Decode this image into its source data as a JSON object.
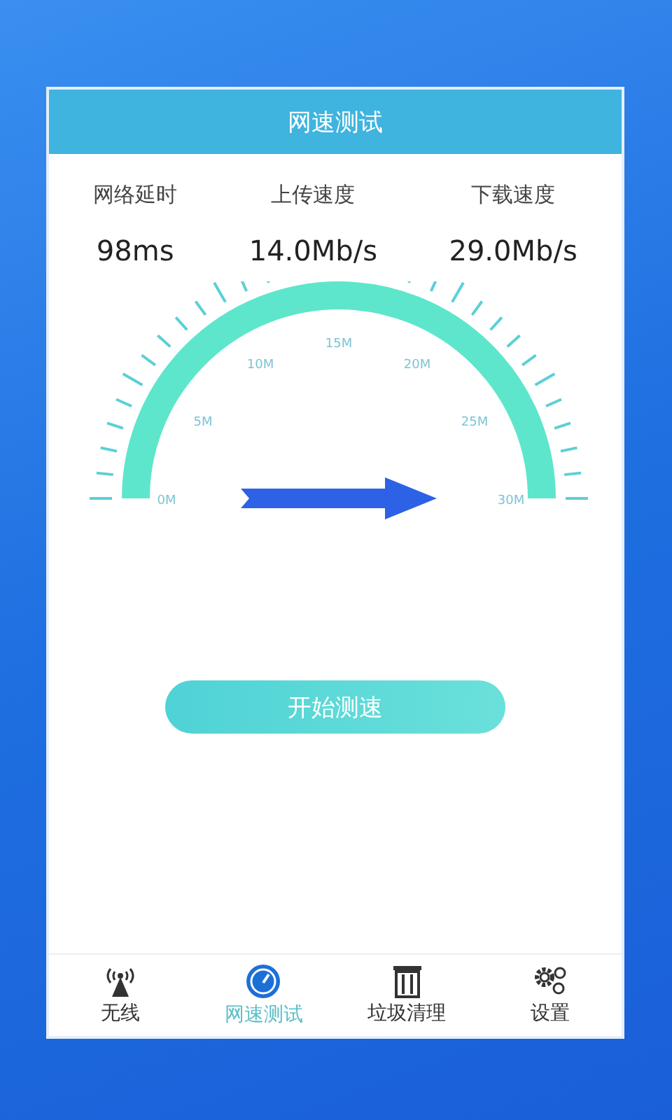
{
  "header": {
    "title": "网速测试"
  },
  "stats": [
    {
      "label": "网络延时",
      "value": "98ms"
    },
    {
      "label": "上传速度",
      "value": "14.0Mb/s"
    },
    {
      "label": "下载速度",
      "value": "29.0Mb/s"
    }
  ],
  "gauge": {
    "scale_labels": [
      "0M",
      "5M",
      "10M",
      "15M",
      "20M",
      "25M",
      "30M"
    ]
  },
  "start_button": "开始测速",
  "tabs": [
    {
      "label": "无线",
      "kind": "antenna",
      "selected": false
    },
    {
      "label": "网速测试",
      "kind": "speed",
      "selected": true
    },
    {
      "label": "垃圾清理",
      "kind": "trash",
      "selected": false
    },
    {
      "label": "设置",
      "kind": "gears",
      "selected": false
    }
  ]
}
